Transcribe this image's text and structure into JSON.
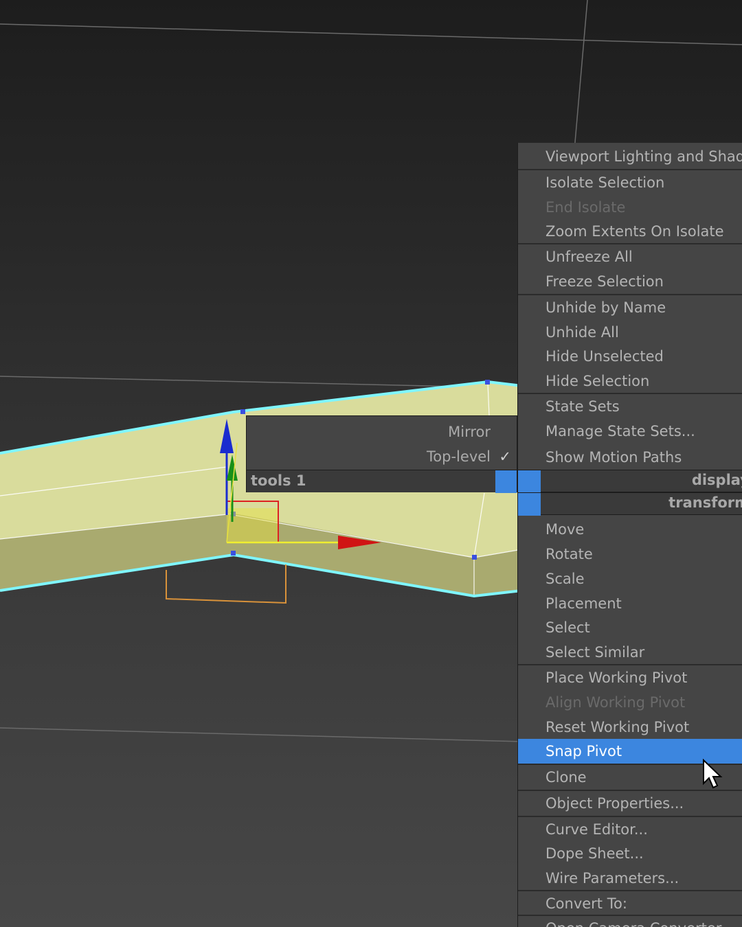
{
  "quad_left": {
    "items": [
      {
        "label": "Mirror",
        "checked": false
      },
      {
        "label": "Top-level",
        "checked": true
      }
    ],
    "check_glyph": "✓",
    "title": "tools 1"
  },
  "quad_right": {
    "group1": [
      "Viewport Lighting and Shadows"
    ],
    "group2": [
      "Isolate Selection",
      "End Isolate",
      "Zoom Extents On Isolate"
    ],
    "group3": [
      "Unfreeze All",
      "Freeze Selection"
    ],
    "group4": [
      "Unhide by Name",
      "Unhide All",
      "Hide Unselected",
      "Hide Selection"
    ],
    "group5": [
      "State Sets",
      "Manage State Sets...",
      "Show Motion Paths"
    ],
    "title_display": "display",
    "title_transform": "transform",
    "group6": [
      "Move",
      "Rotate",
      "Scale",
      "Placement",
      "Select",
      "Select Similar"
    ],
    "group7": [
      "Place Working Pivot",
      "Align Working Pivot",
      "Reset Working Pivot",
      "Snap Pivot"
    ],
    "group8": [
      "Clone"
    ],
    "group9": [
      "Object Properties..."
    ],
    "group10": [
      "Curve Editor...",
      "Dope Sheet...",
      "Wire Parameters..."
    ],
    "group11": [
      "Convert To:",
      "Open Camera Converter"
    ],
    "disabled": [
      "End Isolate",
      "Align Working Pivot"
    ],
    "selected": "Snap Pivot"
  },
  "colors": {
    "accent": "#3c86df",
    "menu_bg": "#454545",
    "text": "#b4b4b4",
    "disabled_text": "#6a6a6a",
    "object_fill": "#d8dc9a",
    "wire": "#7ff6ff"
  },
  "icons": {
    "cursor": "arrow-pointer-icon",
    "gizmo": "transform-gizmo-icon"
  }
}
